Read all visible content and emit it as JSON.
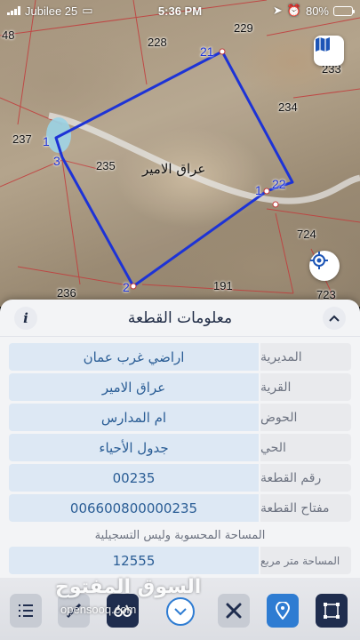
{
  "status_bar": {
    "carrier": "Jubilee 25",
    "time": "5:36 PM",
    "battery": "80%",
    "battery_level": 0.8
  },
  "map": {
    "parcel_labels": [
      "48",
      "228",
      "229",
      "233",
      "234",
      "237",
      "235",
      "724",
      "236",
      "191",
      "723"
    ],
    "vertex_labels": [
      "21",
      "1",
      "3",
      "1",
      "22",
      "2"
    ],
    "parcel_name": "عراق الامير",
    "colors": {
      "boundary": "#1d33d6",
      "road": "#e9e9e9"
    },
    "icons": {
      "layers": "map-layers-icon",
      "locate": "crosshair-icon"
    }
  },
  "sheet": {
    "title": "معلومات القطعة",
    "info_label": "i",
    "rows": [
      {
        "label": "المديرية",
        "value": "اراضي غرب عمان"
      },
      {
        "label": "القرية",
        "value": "عراق الامير"
      },
      {
        "label": "الحوض",
        "value": "ام المدارس"
      },
      {
        "label": "الحي",
        "value": "جدول الأحياء"
      },
      {
        "label": "رقم القطعة",
        "value": "00235"
      },
      {
        "label": "مفتاح القطعة",
        "value": "006600800000235"
      }
    ],
    "area_note": "المساحة المحسوبة وليس التسجيلية",
    "area_row": {
      "label": "المساحة متر مربع",
      "value": "12555"
    }
  },
  "toolbar": {
    "tools": [
      "list-icon",
      "ruler-icon",
      "binoculars-icon",
      "chevron-down-icon",
      "tools-icon",
      "pin-icon",
      "polygon-icon"
    ]
  },
  "watermark": {
    "arabic": "السوق المفتوح",
    "latin": "opensooq.com"
  }
}
